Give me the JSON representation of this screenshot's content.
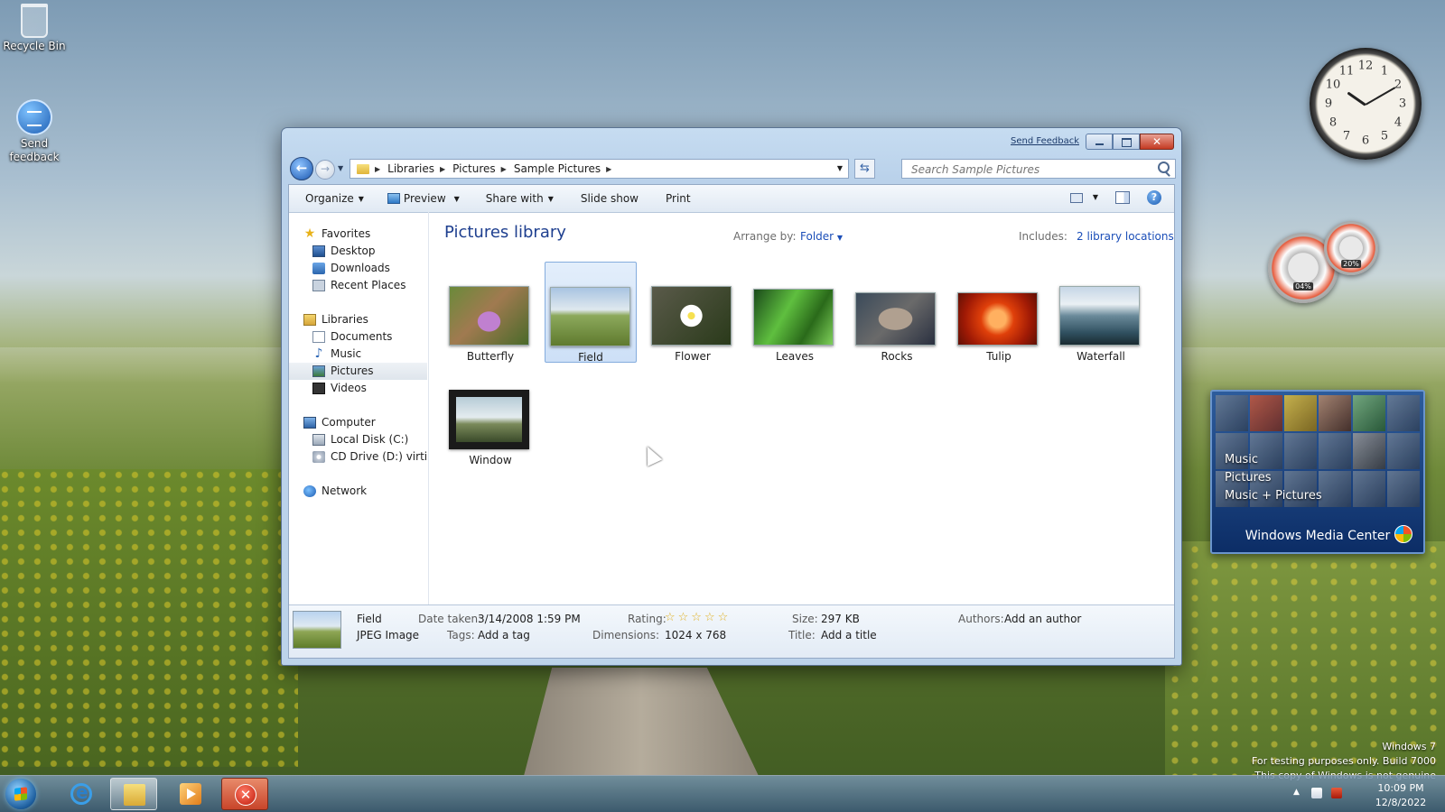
{
  "desktop": {
    "icons": [
      {
        "label": "Recycle Bin"
      },
      {
        "label": "Send feedback"
      }
    ],
    "watermark": {
      "line1": "Windows 7",
      "line2": "For testing purposes only. Build 7000",
      "line3": "This copy of Windows is not genuine"
    },
    "meter": {
      "cpu": "04%",
      "mem": "20%"
    },
    "clock_numbers": [
      "12",
      "1",
      "2",
      "3",
      "4",
      "5",
      "6",
      "7",
      "8",
      "9",
      "10",
      "11"
    ]
  },
  "media_center": {
    "menu": [
      "Music",
      "Pictures",
      "Music + Pictures"
    ],
    "brand": "Windows Media Center"
  },
  "window": {
    "send_feedback": "Send Feedback",
    "address": [
      "Libraries",
      "Pictures",
      "Sample Pictures"
    ],
    "search_placeholder": "Search Sample Pictures",
    "toolbar": {
      "organize": "Organize",
      "preview": "Preview",
      "share_with": "Share with",
      "slide_show": "Slide show",
      "print": "Print"
    },
    "nav": {
      "favorites": "Favorites",
      "desktop": "Desktop",
      "downloads": "Downloads",
      "recent": "Recent Places",
      "libraries": "Libraries",
      "documents": "Documents",
      "music": "Music",
      "pictures": "Pictures",
      "videos": "Videos",
      "computer": "Computer",
      "local_disk": "Local Disk (C:)",
      "cd_drive": "CD Drive (D:) virtio-w",
      "network": "Network"
    },
    "content": {
      "title": "Pictures library",
      "arrange_label": "Arrange by:",
      "arrange_value": "Folder",
      "includes_label": "Includes:",
      "includes_value": "2 library locations",
      "files": [
        "Butterfly",
        "Field",
        "Flower",
        "Leaves",
        "Rocks",
        "Tulip",
        "Waterfall",
        "Window"
      ],
      "selected": "Field"
    },
    "details": {
      "name": "Field",
      "type": "JPEG Image",
      "date_taken_label": "Date taken:",
      "date_taken": "3/14/2008 1:59 PM",
      "tags_label": "Tags:",
      "tags": "Add a tag",
      "rating_label": "Rating:",
      "rating": 0,
      "dimensions_label": "Dimensions:",
      "dimensions": "1024 x 768",
      "size_label": "Size:",
      "size": "297 KB",
      "title_label": "Title:",
      "title": "Add a title",
      "authors_label": "Authors:",
      "authors": "Add an author"
    }
  },
  "taskbar": {
    "time": "10:09 PM",
    "date": "12/8/2022"
  }
}
